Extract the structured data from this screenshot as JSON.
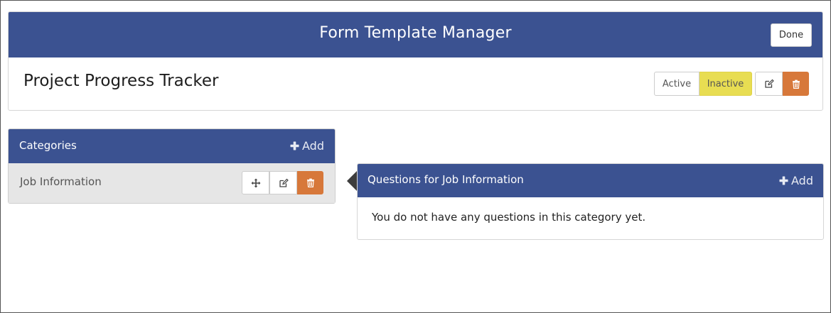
{
  "header": {
    "title": "Form Template Manager",
    "done_label": "Done"
  },
  "form": {
    "name": "Project Progress Tracker",
    "status_options": [
      "Active",
      "Inactive"
    ],
    "selected_status": "Inactive"
  },
  "categories": {
    "title": "Categories",
    "add_label": "Add",
    "items": [
      {
        "label": "Job Information"
      }
    ]
  },
  "questions": {
    "title": "Questions for Job Information",
    "add_label": "Add",
    "empty_message": "You do not have any questions in this category yet."
  },
  "colors": {
    "header_blue": "#3b5291",
    "inactive_yellow": "#e8dd52",
    "delete_orange": "#d7783a"
  },
  "icons": [
    "plus-icon",
    "move-icon",
    "edit-icon",
    "trash-icon"
  ]
}
